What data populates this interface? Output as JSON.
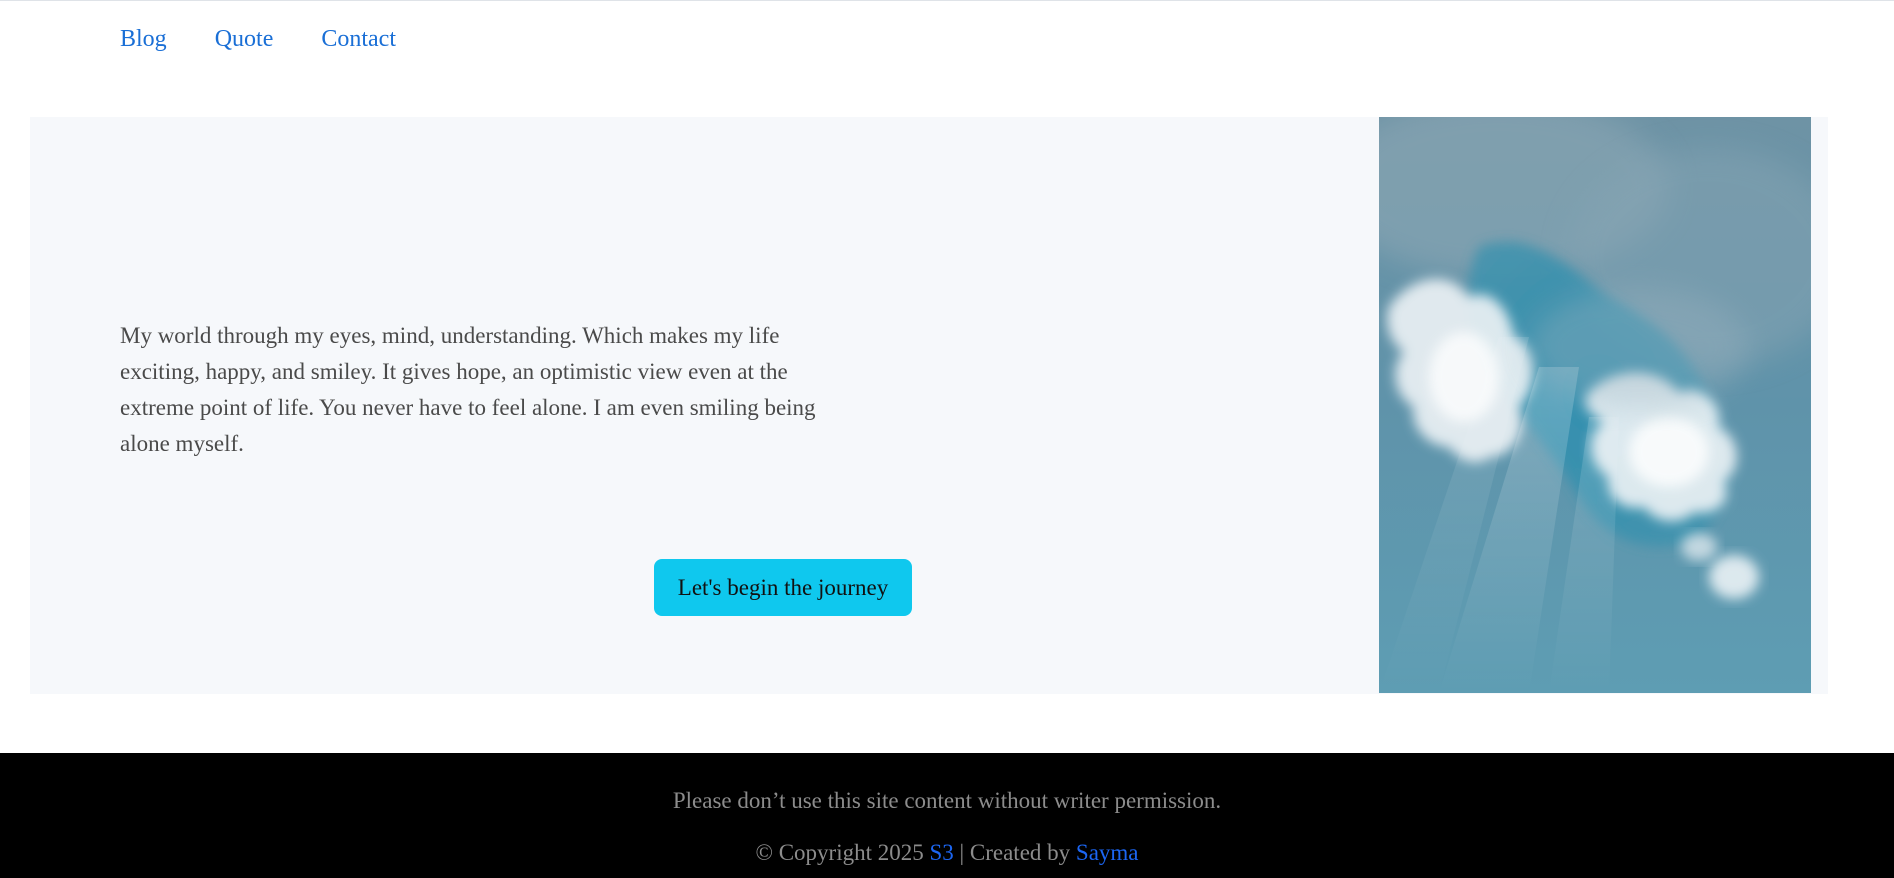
{
  "nav": {
    "items": [
      {
        "label": "Blog"
      },
      {
        "label": "Quote"
      },
      {
        "label": "Contact"
      }
    ]
  },
  "hero": {
    "text": "My world through my eyes, mind, understanding. Which makes my life exciting, happy, and smiley. It gives hope, an optimistic view even at the extreme point of life. You never have to feel alone. I am even smiling being alone myself.",
    "button_label": "Let's begin the journey",
    "image": "sky-with-clouds-image"
  },
  "footer": {
    "notice": "Please don’t use this site content without writer permission.",
    "copyright_prefix": "© Copyright 2025",
    "site_link": "S3",
    "separator": "| Created by",
    "author_link": "Sayma"
  },
  "colors": {
    "link": "#1a6fd6",
    "accent_button": "#0fc8ee",
    "hero_bg": "#f6f8fb",
    "footer_bg": "#000000",
    "footer_text": "#8c8c8c"
  }
}
